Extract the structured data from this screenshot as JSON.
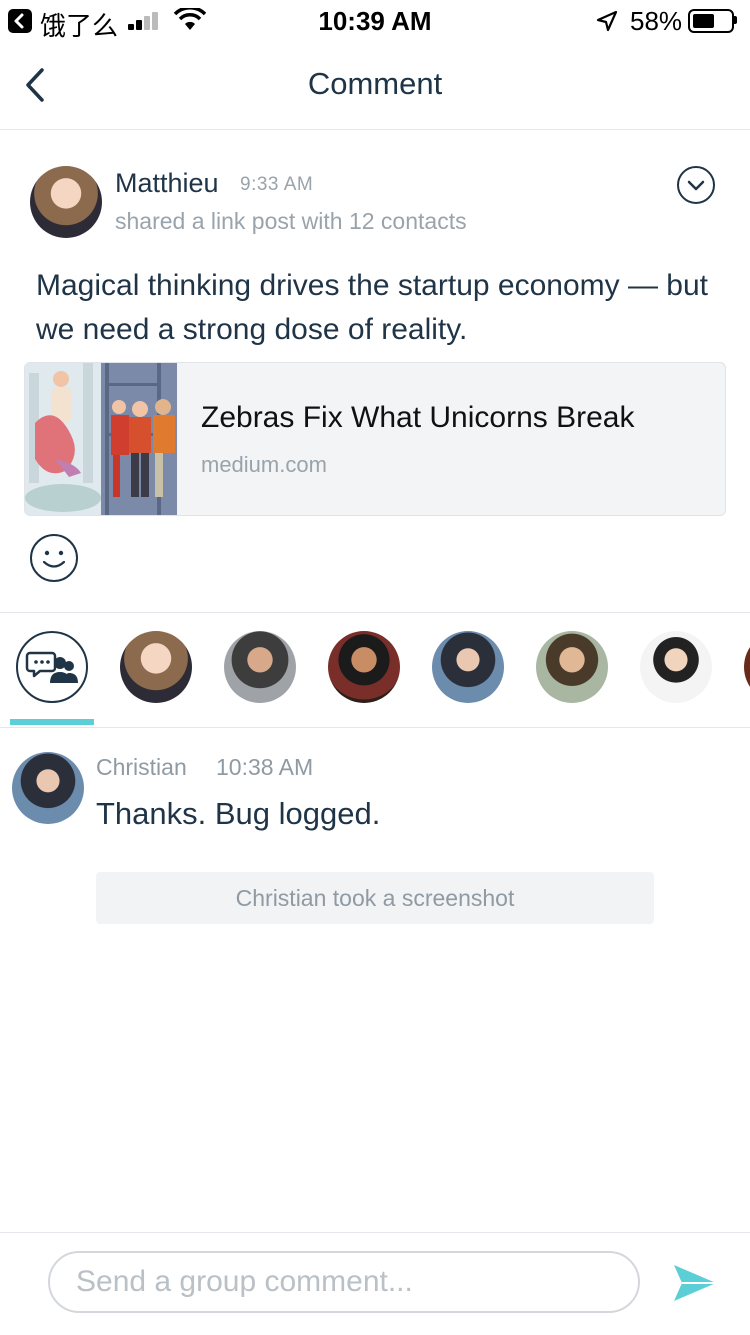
{
  "status_bar": {
    "app": "饿了么",
    "time": "10:39 AM",
    "battery_percent": "58%",
    "battery_level": 0.58
  },
  "nav": {
    "title": "Comment",
    "back_icon": "chevron-left-icon"
  },
  "post": {
    "author": "Matthieu",
    "time": "9:33 AM",
    "shared_text": "shared a link post with 12 contacts",
    "text": "Magical thinking drives the startup economy — but we need a strong dose of reality.",
    "link": {
      "title": "Zebras Fix What Unicorns Break",
      "domain": "medium.com"
    }
  },
  "participants": {
    "active_index": 0,
    "icons": [
      "group-chat-icon"
    ]
  },
  "comments": [
    {
      "author": "Christian",
      "time": "10:38 AM",
      "text": "Thanks. Bug logged."
    }
  ],
  "system_message": "Christian took a screenshot",
  "composer": {
    "placeholder": "Send a group comment...",
    "value": ""
  },
  "colors": {
    "accent": "#5ccfd6",
    "text": "#1f3447",
    "muted": "#99a3ab"
  }
}
